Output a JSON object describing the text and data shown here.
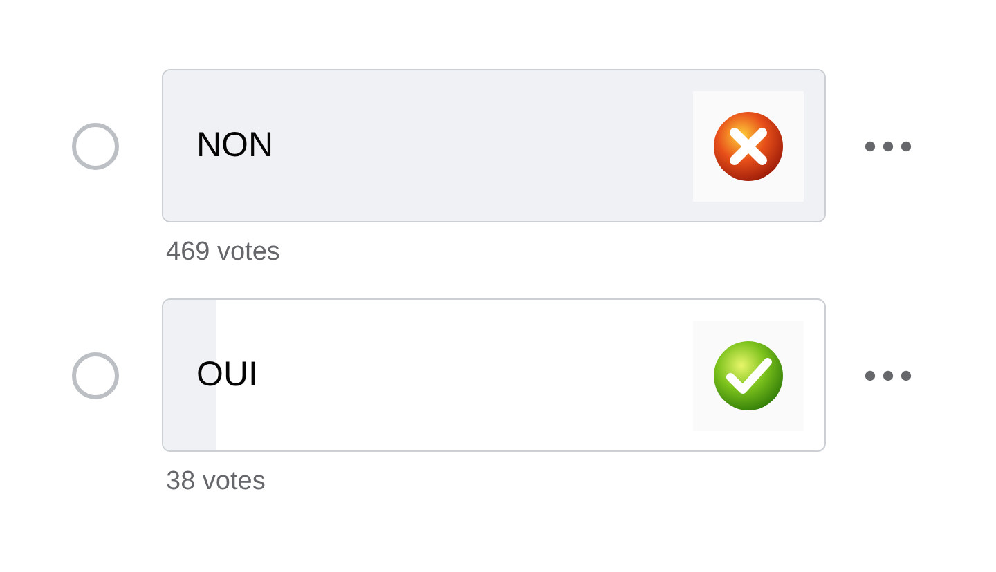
{
  "options": [
    {
      "label": "NON",
      "kind": "cross",
      "level": 1,
      "votes": "469 votes",
      "selected": false
    },
    {
      "label": "OUI",
      "kind": "check",
      "level": 0.08,
      "votes": "38 votes",
      "selected": false
    }
  ]
}
